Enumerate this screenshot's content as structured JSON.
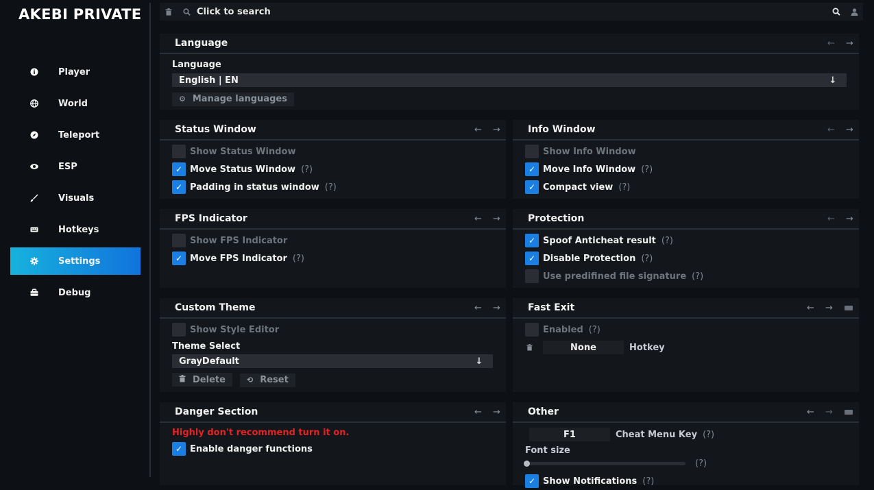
{
  "app": {
    "title": "AKEBI PRIVATE"
  },
  "nav": [
    {
      "label": "Player"
    },
    {
      "label": "World"
    },
    {
      "label": "Teleport"
    },
    {
      "label": "ESP"
    },
    {
      "label": "Visuals"
    },
    {
      "label": "Hotkeys"
    },
    {
      "label": "Settings"
    },
    {
      "label": "Debug"
    }
  ],
  "topbar": {
    "search_placeholder": "Click to search"
  },
  "panels": {
    "language": {
      "title": "Language",
      "field_label": "Language",
      "selected": "English | EN",
      "manage_label": "Manage languages"
    },
    "status_window": {
      "title": "Status Window",
      "items": [
        {
          "label": "Show Status Window",
          "checked": false,
          "help": ""
        },
        {
          "label": "Move Status Window",
          "checked": true,
          "help": "(?)"
        },
        {
          "label": "Padding in status window",
          "checked": true,
          "help": "(?)"
        }
      ]
    },
    "info_window": {
      "title": "Info Window",
      "items": [
        {
          "label": "Show Info Window",
          "checked": false,
          "help": ""
        },
        {
          "label": "Move Info Window",
          "checked": true,
          "help": "(?)"
        },
        {
          "label": "Compact view",
          "checked": true,
          "help": "(?)"
        }
      ]
    },
    "fps": {
      "title": "FPS Indicator",
      "items": [
        {
          "label": "Show FPS Indicator",
          "checked": false,
          "help": ""
        },
        {
          "label": "Move FPS Indicator",
          "checked": true,
          "help": "(?)"
        }
      ]
    },
    "protection": {
      "title": "Protection",
      "items": [
        {
          "label": "Spoof Anticheat result",
          "checked": true,
          "help": "(?)"
        },
        {
          "label": "Disable Protection",
          "checked": true,
          "help": "(?)"
        },
        {
          "label": "Use predifined file signature",
          "checked": false,
          "help": "(?)"
        }
      ]
    },
    "custom_theme": {
      "title": "Custom Theme",
      "show_editor": "Show Style Editor",
      "select_label": "Theme Select",
      "selected": "GrayDefault",
      "delete_label": "Delete",
      "reset_label": "Reset"
    },
    "fast_exit": {
      "title": "Fast Exit",
      "enabled_label": "Enabled",
      "help": "(?)",
      "key_value": "None",
      "key_label": "Hotkey"
    },
    "danger": {
      "title": "Danger Section",
      "warning": "Highly don't recommend turn it on.",
      "enable_label": "Enable danger functions"
    },
    "other": {
      "title": "Other",
      "key_value": "F1",
      "key_label": "Cheat Menu Key",
      "key_help": "(?)",
      "font_label": "Font size",
      "font_help": "(?)",
      "font_level": 0,
      "notif_label": "Show Notifications",
      "notif_help": "(?)"
    }
  },
  "colors": {
    "accent": "#1a7fe3",
    "nav_active_start": "#17b2dd",
    "nav_active_end": "#1173dc",
    "danger": "#e02424"
  }
}
